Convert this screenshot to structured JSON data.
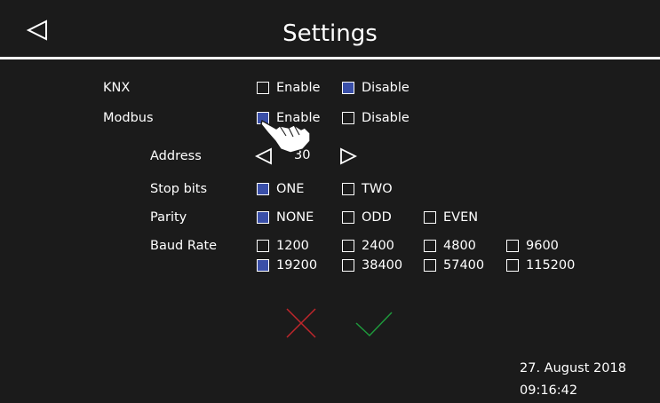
{
  "header": {
    "title": "Settings",
    "back_icon": "back-triangle-icon"
  },
  "knx": {
    "label": "KNX",
    "options": [
      {
        "label": "Enable",
        "checked": false
      },
      {
        "label": "Disable",
        "checked": true
      }
    ]
  },
  "modbus": {
    "label": "Modbus",
    "options": [
      {
        "label": "Enable",
        "checked": true
      },
      {
        "label": "Disable",
        "checked": false
      }
    ]
  },
  "address": {
    "label": "Address",
    "value": "30"
  },
  "stop_bits": {
    "label": "Stop bits",
    "options": [
      {
        "label": "ONE",
        "checked": true
      },
      {
        "label": "TWO",
        "checked": false
      }
    ]
  },
  "parity": {
    "label": "Parity",
    "options": [
      {
        "label": "NONE",
        "checked": true
      },
      {
        "label": "ODD",
        "checked": false
      },
      {
        "label": "EVEN",
        "checked": false
      }
    ]
  },
  "baud_rate": {
    "label": "Baud Rate",
    "options": [
      {
        "label": "1200",
        "checked": false
      },
      {
        "label": "2400",
        "checked": false
      },
      {
        "label": "4800",
        "checked": false
      },
      {
        "label": "9600",
        "checked": false
      },
      {
        "label": "19200",
        "checked": true
      },
      {
        "label": "38400",
        "checked": false
      },
      {
        "label": "57400",
        "checked": false
      },
      {
        "label": "115200",
        "checked": false
      }
    ]
  },
  "actions": {
    "cancel_icon": "cross-icon",
    "confirm_icon": "checkmark-icon",
    "cancel_color": "#c0262b",
    "confirm_color": "#1e9a3c"
  },
  "status": {
    "date": "27. August 2018",
    "time": "09:16:42"
  },
  "colors": {
    "background": "#1b1b1b",
    "checked": "#3a4fa8",
    "text": "#ffffff"
  }
}
